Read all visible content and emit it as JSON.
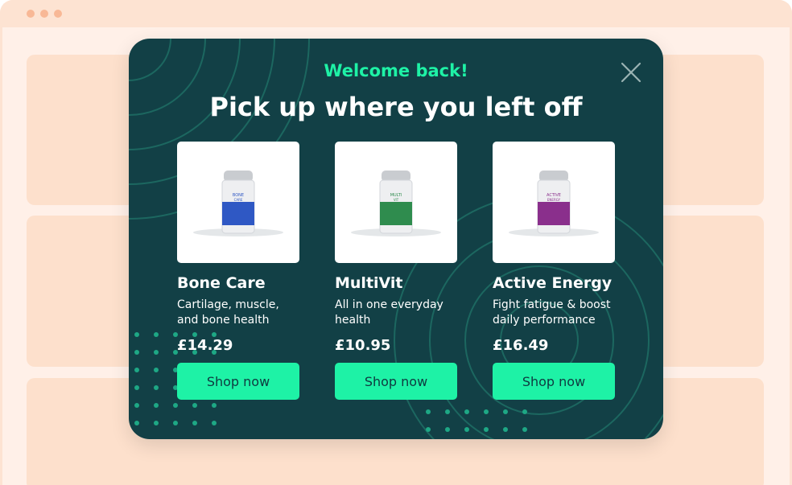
{
  "popup": {
    "welcome": "Welcome back!",
    "headline": "Pick up where you left off",
    "close_icon": "close-icon"
  },
  "products": [
    {
      "name": "Bone Care",
      "desc_line1": "Cartilage, muscle,",
      "desc_line2": "and bone health",
      "price": "£14.29",
      "cta": "Shop now",
      "label_top": "BONE",
      "label_bottom": "CARE",
      "accent": "#2f58c4"
    },
    {
      "name": "MultiVit",
      "desc_line1": "All in one everyday",
      "desc_line2": "health",
      "price": "£10.95",
      "cta": "Shop now",
      "label_top": "MULTI",
      "label_bottom": "VIT",
      "accent": "#2f8c4e"
    },
    {
      "name": "Active Energy",
      "desc_line1": "Fight fatigue & boost",
      "desc_line2": "daily performance",
      "price": "£16.49",
      "cta": "Shop now",
      "label_top": "ACTIVE",
      "label_bottom": "ENERGY",
      "accent": "#8a2f8c"
    }
  ],
  "colors": {
    "popup_bg": "#124046",
    "accent": "#1ef2a6",
    "page_bg": "#fde3d2"
  }
}
